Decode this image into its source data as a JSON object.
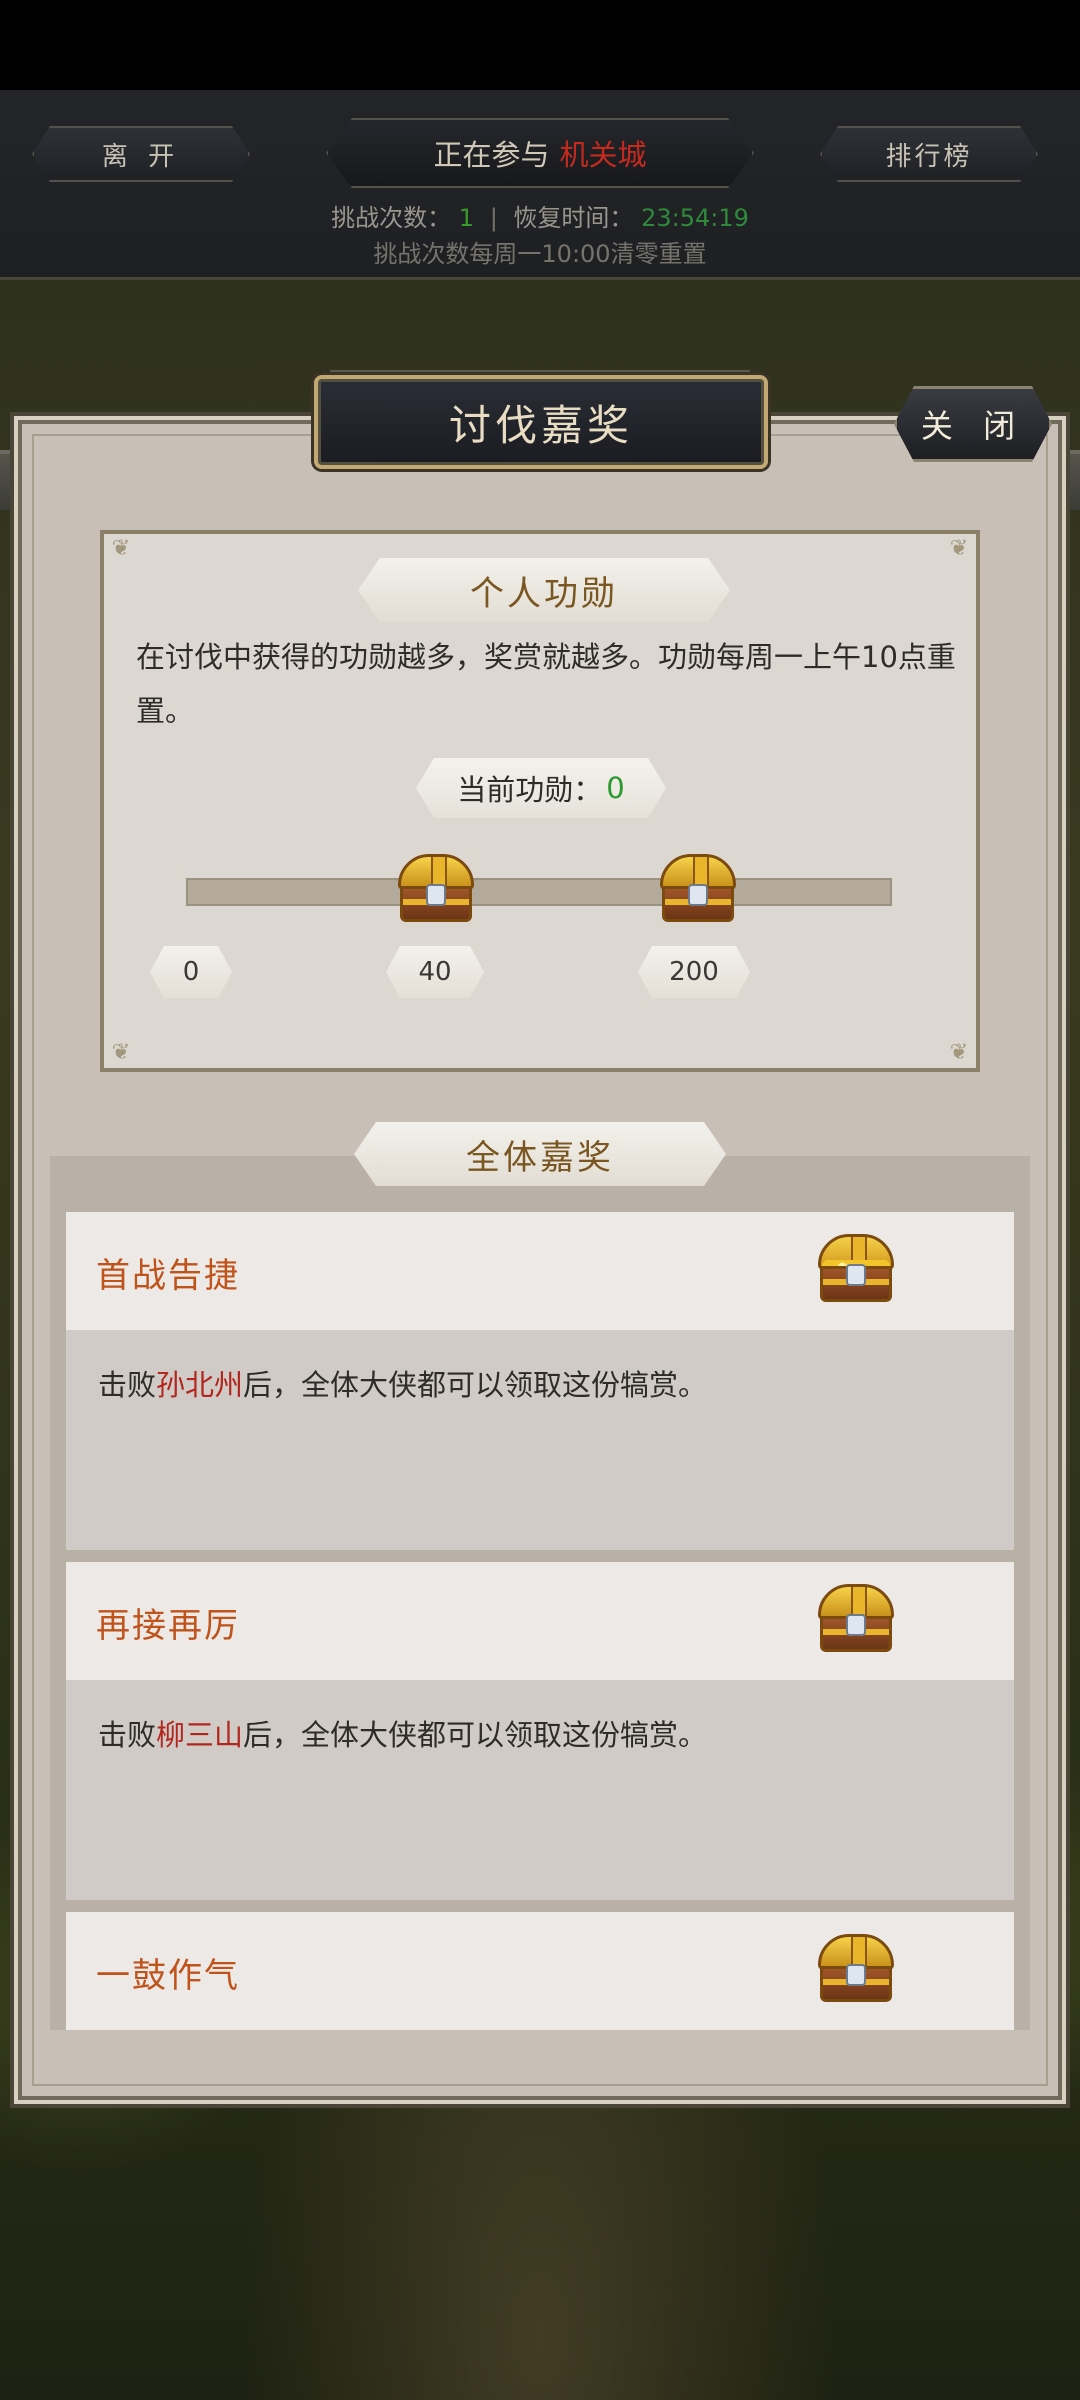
{
  "hud": {
    "leave_label": "离 开",
    "participating_prefix": "正在参与",
    "participating_place": "机关城",
    "rank_label": "排行榜",
    "challenge_count_label": "挑战次数：",
    "challenge_count": "1",
    "recovery_label": "恢复时间：",
    "recovery_time": "23:54:19",
    "reset_note": "挑战次数每周一10:00清零重置"
  },
  "panel": {
    "title": "讨伐嘉奖",
    "close_label": "关 闭"
  },
  "personal": {
    "title": "个人功勋",
    "description": "在讨伐中获得的功勋越多，奖赏就越多。功勋每周一上午10点重置。",
    "current_merit_label": "当前功勋：",
    "current_merit_value": "0",
    "progress_fraction": 0,
    "scale_labels": [
      "0",
      "40",
      "200"
    ]
  },
  "global": {
    "title": "全体嘉奖",
    "rewards": [
      {
        "name": "首战告捷",
        "desc_prefix": "击败",
        "boss": "孙北州",
        "desc_suffix": "后，全体大侠都可以领取这份犒赏。",
        "chest_icon": "open-treasure-chest-icon"
      },
      {
        "name": "再接再厉",
        "desc_prefix": "击败",
        "boss": "柳三山",
        "desc_suffix": "后，全体大侠都可以领取这份犒赏。",
        "chest_icon": "treasure-chest-icon"
      },
      {
        "name": "一鼓作气",
        "chest_icon": "treasure-chest-icon"
      }
    ]
  },
  "colors": {
    "accent_red": "#c62a1f",
    "merit_green": "#2b9a2e",
    "reward_name_orange": "#c0531a"
  }
}
